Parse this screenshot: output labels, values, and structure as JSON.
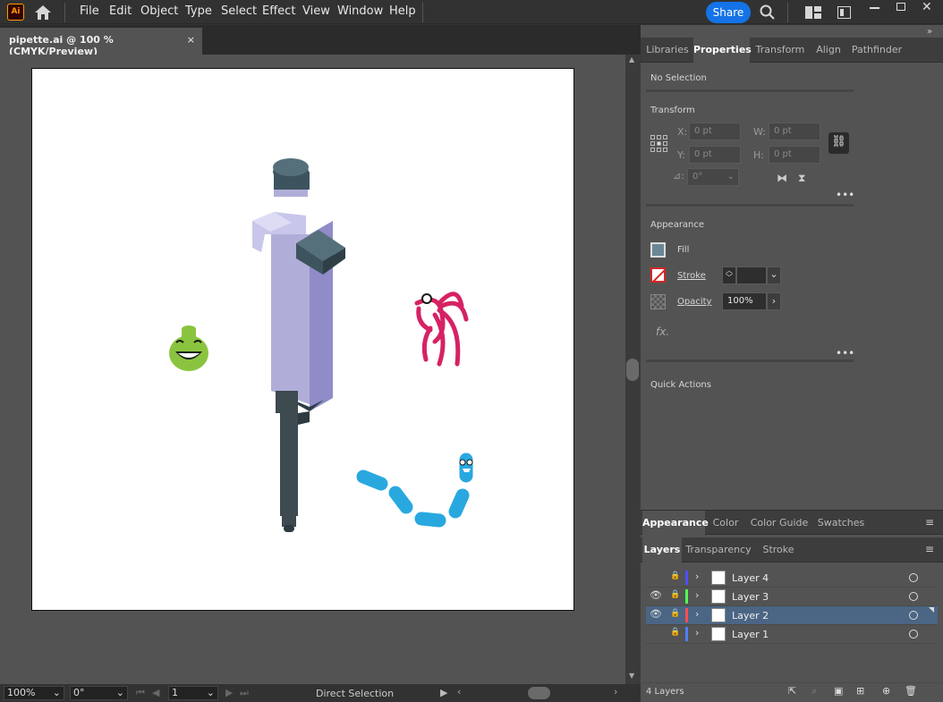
{
  "menu": {
    "items": [
      "File",
      "Edit",
      "Object",
      "Type",
      "Select",
      "Effect",
      "View",
      "Window",
      "Help"
    ],
    "share": "Share",
    "app_logo": "Ai"
  },
  "document": {
    "tab_title": "pipette.ai @ 100 % (CMYK/Preview)",
    "close": "×"
  },
  "status": {
    "zoom": "100%",
    "rotation": "0°",
    "artboard": "1",
    "tool": "Direct Selection"
  },
  "properties_tabs": [
    "Libraries",
    "Properties",
    "Transform",
    "Align",
    "Pathfinder"
  ],
  "properties": {
    "selection": "No Selection",
    "transform": {
      "title": "Transform",
      "x_label": "X:",
      "y_label": "Y:",
      "w_label": "W:",
      "h_label": "H:",
      "x": "0 pt",
      "y": "0 pt",
      "w": "0 pt",
      "h": "0 pt",
      "angle": "0°"
    },
    "appearance": {
      "title": "Appearance",
      "fill": "Fill",
      "stroke": "Stroke",
      "opacity": "Opacity",
      "opacity_value": "100%",
      "fx": "fx."
    },
    "quick_actions": "Quick Actions"
  },
  "appearance_tabs": [
    "Appearance",
    "Color",
    "Color Guide",
    "Swatches"
  ],
  "layers_tabs": [
    "Layers",
    "Transparency",
    "Stroke"
  ],
  "layers": [
    {
      "name": "Layer 4",
      "color": "#4f4fff",
      "visible": false,
      "selected": false
    },
    {
      "name": "Layer 3",
      "color": "#4fff4f",
      "visible": true,
      "selected": false
    },
    {
      "name": "Layer 2",
      "color": "#ff4f4f",
      "visible": true,
      "selected": true
    },
    {
      "name": "Layer 1",
      "color": "#4f80ff",
      "visible": false,
      "selected": false
    }
  ],
  "layers_footer": "4 Layers",
  "colors": {
    "accent": "#1473e6"
  }
}
